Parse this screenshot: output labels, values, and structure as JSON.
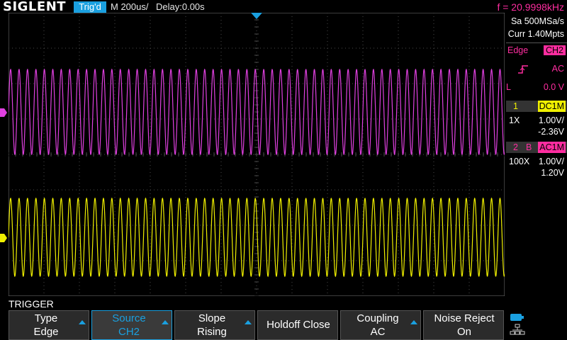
{
  "topbar": {
    "brand": "SIGLENT",
    "trig_status": "Trig'd",
    "timebase": "M 200us/",
    "delay": "Delay:0.00s",
    "frequency": "f = 20.9998kHz"
  },
  "acquisition": {
    "sample_rate": "Sa 500MSa/s",
    "memory": "Curr 1.40Mpts"
  },
  "trigger_panel": {
    "type": "Edge",
    "source": "CH2",
    "coupling": "AC",
    "level_label": "L",
    "level": "0.0 V",
    "slope_icon": "rising-edge-icon"
  },
  "channels": [
    {
      "num": "1",
      "bandwidth": "",
      "coupling": "DC1M",
      "probe": "1X",
      "scale": "1.00V/",
      "offset": "-2.36V",
      "color": "#f0f000"
    },
    {
      "num": "2",
      "bandwidth": "B",
      "coupling": "AC1M",
      "probe": "100X",
      "scale": "1.00V/",
      "offset": "1.20V",
      "color": "#ff2da0"
    }
  ],
  "menu": {
    "title": "TRIGGER",
    "softkeys": [
      {
        "l1": "Type",
        "l2": "Edge",
        "arrow": true,
        "active": false
      },
      {
        "l1": "Source",
        "l2": "CH2",
        "arrow": true,
        "active": true
      },
      {
        "l1": "Slope",
        "l2": "Rising",
        "arrow": true,
        "active": false
      },
      {
        "single": "Holdoff Close",
        "arrow": false,
        "active": false
      },
      {
        "l1": "Coupling",
        "l2": "AC",
        "arrow": true,
        "active": false
      },
      {
        "l1": "Noise Reject",
        "l2": "On",
        "arrow": false,
        "active": false
      }
    ]
  },
  "markers": {
    "ch1_label": "1",
    "ch2_label": "2"
  },
  "colors": {
    "accent": "#1aa0e0",
    "ch1": "#f0f000",
    "ch2": "#ff2da0",
    "grid": "#4a4a4a"
  }
}
